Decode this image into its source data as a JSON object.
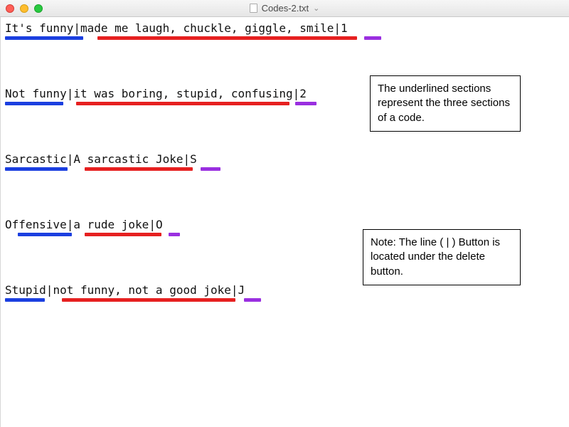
{
  "window": {
    "filename": "Codes-2.txt"
  },
  "colors": {
    "blue": "#1b3fe0",
    "red": "#e62020",
    "purple": "#9a2fe0"
  },
  "lines": [
    {
      "part1": "It's funny",
      "part2": "made me laugh, chuckle, giggle, smile",
      "part3": "1",
      "seg": {
        "blueL": 0,
        "blueW": 110,
        "redL": 130,
        "redW": 365,
        "purL": 505,
        "purW": 24
      }
    },
    {
      "part1": "Not funny",
      "part2": "it was boring, stupid, confusing",
      "part3": "2",
      "seg": {
        "blueL": 0,
        "blueW": 82,
        "redL": 100,
        "redW": 300,
        "purL": 408,
        "purW": 30
      }
    },
    {
      "part1": "Sarcastic",
      "part2": "A sarcastic Joke",
      "part3": "S",
      "seg": {
        "blueL": 0,
        "blueW": 88,
        "redL": 112,
        "redW": 152,
        "purL": 275,
        "purW": 28
      }
    },
    {
      "part1": "Offensive",
      "part2": "a rude joke",
      "part3": "O",
      "seg": {
        "blueL": 18,
        "blueW": 76,
        "redL": 112,
        "redW": 108,
        "purL": 230,
        "purW": 16
      }
    },
    {
      "part1": "Stupid",
      "part2": "not funny, not a good joke",
      "part3": "J",
      "seg": {
        "blueL": 0,
        "blueW": 56,
        "redL": 80,
        "redW": 244,
        "purL": 336,
        "purW": 24
      }
    }
  ],
  "annotations": {
    "note1": "The underlined sections represent the three sections of a code.",
    "note2": "Note: The line ( | ) Button is located under the delete button."
  }
}
